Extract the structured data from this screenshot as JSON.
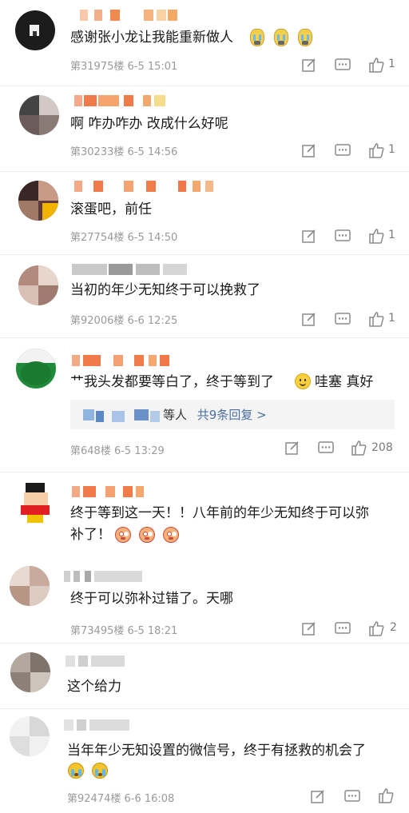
{
  "comments": [
    {
      "text": "感谢张小龙让我能重新做人",
      "floor": "第31975楼 6-5 15:01",
      "likes": "1"
    },
    {
      "text": "啊 咋办咋办 改成什么好呢",
      "floor": "第30233楼 6-5 14:56",
      "likes": "1"
    },
    {
      "text": "滚蛋吧，前任",
      "floor": "第27754楼 6-5 14:50",
      "likes": "1"
    },
    {
      "text": "当初的年少无知终于可以挽救了",
      "floor": "第92006楼 6-6 12:25",
      "likes": "1"
    },
    {
      "text": "艹我头发都要等白了，终于等到了",
      "text_after": "哇塞 真好",
      "floor": "第648楼 6-5 13:29",
      "likes": "208",
      "reply_summary": {
        "prefix": "等人",
        "link": "共9条回复 >"
      }
    },
    {
      "text_line1": "终于等到这一天！！八年前的年少无知终于可以弥",
      "text_line2": "补了！"
    },
    {
      "text": "终于可以弥补过错了。天哪",
      "floor": "第73495楼 6-5 18:21",
      "likes": "2"
    },
    {
      "text": "这个给力"
    },
    {
      "text": "当年年少无知设置的微信号，终于有拯救的机会了",
      "floor": "第92474楼 6-6 16:08"
    }
  ],
  "icons": {
    "edit": "edit-icon",
    "comment": "comment-icon",
    "like": "thumbs-up-icon"
  },
  "colors": {
    "meta_text": "#9a9a9a",
    "link": "#4a6fa5",
    "reply_bg": "#f4f4f4"
  }
}
